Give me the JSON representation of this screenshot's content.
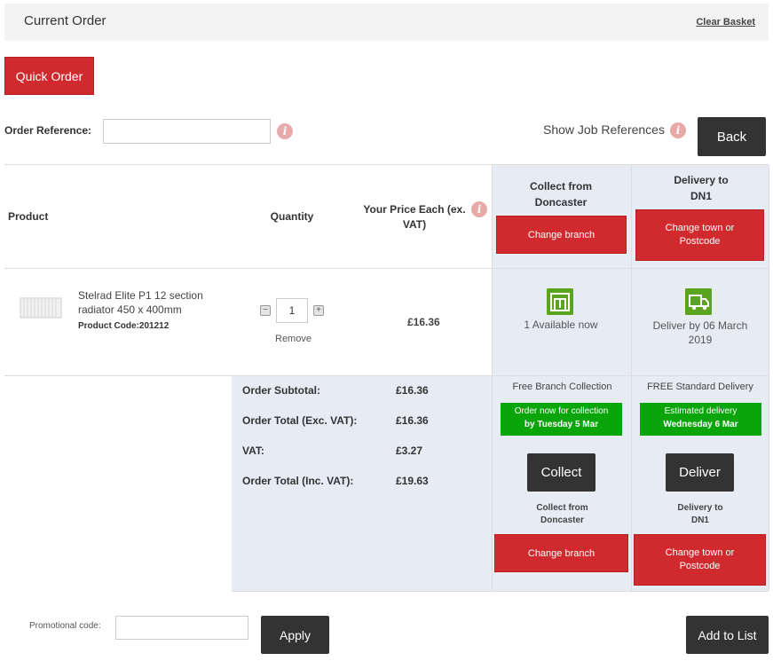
{
  "header": {
    "title": "Current Order",
    "clear_basket": "Clear Basket"
  },
  "quick_order_label": "Quick Order",
  "order_reference": {
    "label": "Order Reference:",
    "value": "",
    "info_icon": "i"
  },
  "job_refs": {
    "label": "Show Job References",
    "info_icon": "i"
  },
  "back_label": "Back",
  "table": {
    "headers": {
      "product": "Product",
      "quantity": "Quantity",
      "price": "Your Price Each  (ex. VAT)",
      "price_info_icon": "i",
      "collect": "Collect from Doncaster",
      "delivery": "Delivery to DN1"
    },
    "change_branch": "Change branch",
    "change_postcode": "Change town or Postcode",
    "row": {
      "name": "Stelrad Elite P1 12 section radiator 450 x 400mm",
      "code": "Product Code:201212",
      "quantity": "1",
      "qty_minus": "−",
      "qty_plus": "+",
      "remove": "Remove",
      "price": "£16.36",
      "available": "1 Available now",
      "deliver_by": "Deliver by 06 March 2019"
    }
  },
  "summary": {
    "subtotal_label": "Order Subtotal:",
    "subtotal": "£16.36",
    "total_ex_label": "Order Total (Exc. VAT):",
    "total_ex": "£16.36",
    "vat_label": "VAT:",
    "vat": "£3.27",
    "total_inc_label": "Order Total (Inc. VAT):",
    "total_inc": "£19.63"
  },
  "collect_panel": {
    "heading": "Free Branch Collection",
    "note_line1": "Order now for collection",
    "note_line2": "by Tuesday 5 Mar",
    "button": "Collect",
    "location_line1": "Collect from",
    "location_line2": "Doncaster",
    "change": "Change branch"
  },
  "delivery_panel": {
    "heading": "FREE Standard Delivery",
    "note_line1": "Estimated delivery",
    "note_line2": "Wednesday 6 Mar",
    "button": "Deliver",
    "location_line1": "Delivery to",
    "location_line2": "DN1",
    "change": "Change town or Postcode"
  },
  "promo": {
    "label": "Promotional code:",
    "value": "",
    "apply": "Apply"
  },
  "add_to_list": "Add to List",
  "colors": {
    "accent_red": "#d02a2e",
    "dark_button": "#333333",
    "success_green": "#0aa50a",
    "panel_blue": "#e6ebf4",
    "icon_green": "#5aa41f"
  }
}
